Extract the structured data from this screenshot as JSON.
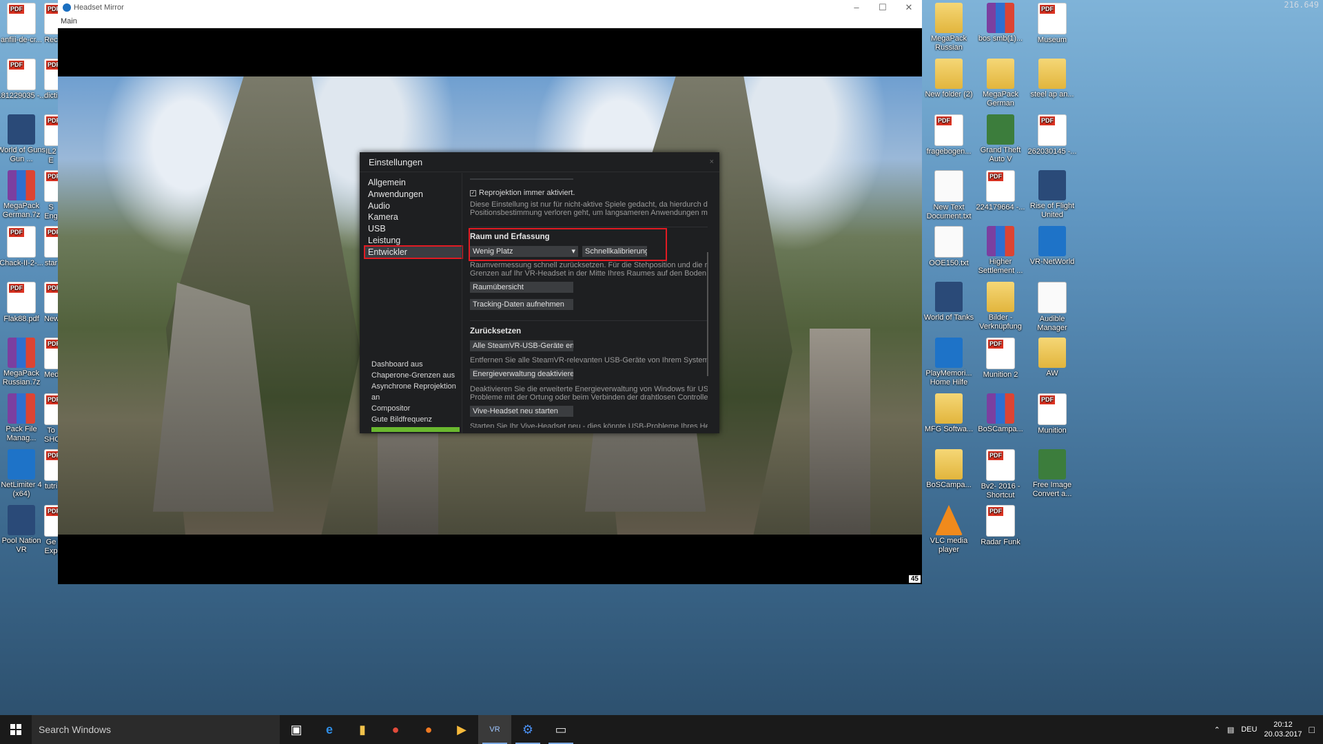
{
  "desktop": {
    "top_right_text": "216.649",
    "left_icons": [
      {
        "label": "anfiii-de-cr...",
        "kind": "pdf"
      },
      {
        "label": "181229035 -...",
        "kind": "pdf"
      },
      {
        "label": "World of Guns Gun ...",
        "kind": "app"
      },
      {
        "label": "MegaPack German.7z",
        "kind": "rar"
      },
      {
        "label": "Chack-II-2-...",
        "kind": "pdf"
      },
      {
        "label": "Flak88.pdf",
        "kind": "pdf"
      },
      {
        "label": "MegaPack Russian.7z",
        "kind": "rar"
      },
      {
        "label": "Pack File Manag...",
        "kind": "rar"
      },
      {
        "label": "NetLimiter 4 (x64)",
        "kind": "blue"
      },
      {
        "label": "Pool Nation VR",
        "kind": "app"
      }
    ],
    "left_col2_partial": [
      "Rec",
      "dictio",
      "IL2 E",
      "S Eng",
      "star",
      "New",
      "Med",
      "To SHO",
      "tutri",
      "Ge Exp"
    ],
    "right_icons": [
      {
        "label": "MegaPack Russian",
        "kind": "folder"
      },
      {
        "label": "bos smb(1)...",
        "kind": "rar"
      },
      {
        "label": "Museum",
        "kind": "pdf"
      },
      {
        "label": "New folder (2)",
        "kind": "folder"
      },
      {
        "label": "MegaPack German",
        "kind": "folder"
      },
      {
        "label": "steel ap an...",
        "kind": "folder"
      },
      {
        "label": "fragebogen...",
        "kind": "pdf"
      },
      {
        "label": "Grand Theft Auto V",
        "kind": "green"
      },
      {
        "label": "262030145 -...",
        "kind": "pdf"
      },
      {
        "label": "New Text Document.txt",
        "kind": "doc"
      },
      {
        "label": "224179664 -...",
        "kind": "pdf"
      },
      {
        "label": "Rise of Flight United",
        "kind": "app"
      },
      {
        "label": "OOE150.txt",
        "kind": "doc"
      },
      {
        "label": "Higher Settlement ...",
        "kind": "rar"
      },
      {
        "label": "VR-NetWorld",
        "kind": "blue"
      },
      {
        "label": "World of Tanks",
        "kind": "app"
      },
      {
        "label": "Bilder - Verknüpfung",
        "kind": "folder"
      },
      {
        "label": "Audible Manager",
        "kind": "doc"
      },
      {
        "label": "PlayMemori... Home Hilfe",
        "kind": "blue"
      },
      {
        "label": "Munition 2",
        "kind": "pdf"
      },
      {
        "label": "AW",
        "kind": "folder"
      },
      {
        "label": "MFG Softwa...",
        "kind": "folder"
      },
      {
        "label": "BoSCampa...",
        "kind": "rar"
      },
      {
        "label": "Munition",
        "kind": "pdf"
      },
      {
        "label": "BoSCampa...",
        "kind": "folder"
      },
      {
        "label": "Bv2- 2016 - Shortcut",
        "kind": "pdf"
      },
      {
        "label": "Free Image Convert a...",
        "kind": "green"
      },
      {
        "label": "VLC media player",
        "kind": "orange"
      },
      {
        "label": "Radar Funk",
        "kind": "pdf"
      }
    ]
  },
  "window": {
    "title": "Headset Mirror",
    "menu": "Main",
    "fps": "45"
  },
  "settings": {
    "title": "Einstellungen",
    "close": "×",
    "nav": [
      "Allgemein",
      "Anwendungen",
      "Audio",
      "Kamera",
      "USB",
      "Leistung",
      "Entwickler"
    ],
    "active_nav": "Entwickler",
    "status_lines": [
      "Dashboard aus",
      "Chaperone-Grenzen aus",
      "Asynchrone Reprojektion an",
      "Compositor",
      "Gute Bildfrequenz"
    ],
    "reprojection_checkbox": "Reprojektion immer aktiviert.",
    "reprojection_desc_1": "Diese Einstellung ist nur für nicht-aktive Spiele gedacht, da hierdurch die vert",
    "reprojection_desc_2": "Positionsbestimmung verloren geht, um langsameren Anwendungen mehr Ze",
    "room_title": "Raum und Erfassung",
    "room_select": "Wenig Platz",
    "quick_calibration": "Schnellkalibrierung",
    "room_desc_1": "Raumvermessung schnell zurücksetzen. Für die Stehposition und die raumfü",
    "room_desc_2": "Grenzen auf Ihr VR-Headset in der Mitte Ihres Raumes auf den Boden zentri",
    "room_overview": "Raumübersicht",
    "tracking_record": "Tracking-Daten aufnehmen",
    "reset_title": "Zurücksetzen",
    "remove_usb": "Alle SteamVR-USB-Geräte entfer",
    "remove_usb_desc": "Entfernen Sie alle SteamVR-relevanten USB-Geräte von Ihrem System, um ih",
    "disable_power": "Energieverwaltung deaktivieren",
    "disable_power_desc_1": "Deaktivieren Sie die erweiterte Energieverwaltung von Windows für USB-Gerä",
    "disable_power_desc_2": "Probleme mit der Ortung oder beim Verbinden der drahtlosen Controller habe",
    "restart_vive": "Vive-Headset neu starten",
    "restart_vive_desc": "Starten Sie Ihr Vive-Headset neu - dies könnte USB-Probleme Ihres Headsets"
  },
  "taskbar": {
    "search_placeholder": "Search Windows",
    "language": "DEU",
    "time": "20:12",
    "date": "20.03.2017"
  },
  "colors": {
    "highlight_red": "#e21b23",
    "good_frame_green": "#6ab82f"
  }
}
